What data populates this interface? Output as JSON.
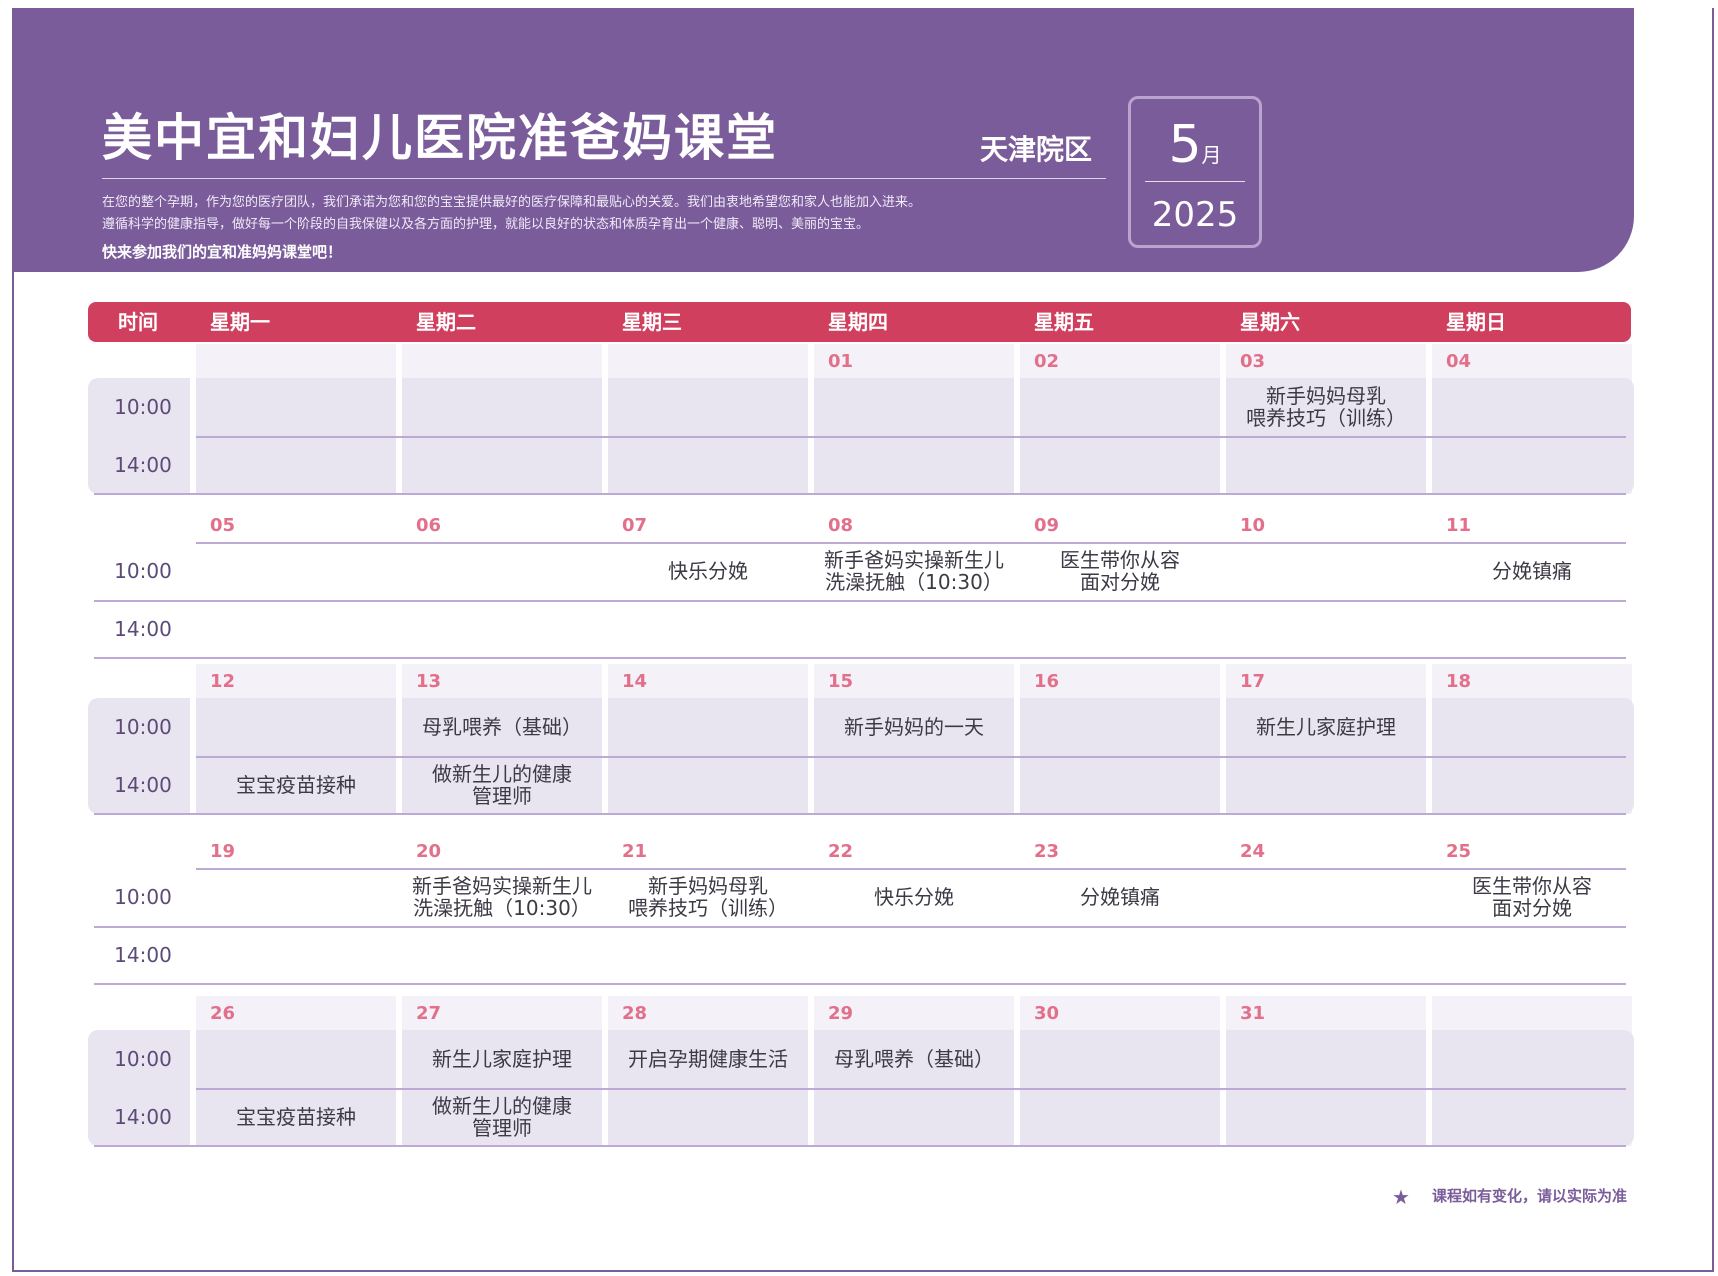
{
  "header": {
    "title": "美中宜和妇儿医院准爸妈课堂",
    "campus": "天津院区",
    "intro_lines": [
      "在您的整个孕期，作为您的医疗团队，我们承诺为您和您的宝宝提供最好的医疗保障和最贴心的关爱。我们由衷地希望您和家人也能加入进来。",
      "遵循科学的健康指导，做好每一个阶段的自我保健以及各方面的护理，就能以良好的状态和体质孕育出一个健康、聪明、美丽的宝宝。"
    ],
    "cta": "快来参加我们的宜和准妈妈课堂吧！",
    "month_num": "5",
    "month_unit": "月",
    "year": "2025"
  },
  "columns": [
    "时间",
    "星期一",
    "星期二",
    "星期三",
    "星期四",
    "星期五",
    "星期六",
    "星期日"
  ],
  "times": [
    "10:00",
    "14:00"
  ],
  "weeks": [
    {
      "dates": [
        "",
        "",
        "",
        "01",
        "02",
        "03",
        "04"
      ],
      "am": [
        "",
        "",
        "",
        "",
        "",
        "新手妈妈母乳\n喂养技巧（训练）",
        ""
      ],
      "pm": [
        "",
        "",
        "",
        "",
        "",
        "",
        ""
      ]
    },
    {
      "dates": [
        "05",
        "06",
        "07",
        "08",
        "09",
        "10",
        "11"
      ],
      "am": [
        "",
        "",
        "快乐分娩",
        "新手爸妈实操新生儿\n洗澡抚触（10:30）",
        "医生带你从容\n面对分娩",
        "",
        "分娩镇痛"
      ],
      "pm": [
        "",
        "",
        "",
        "",
        "",
        "",
        ""
      ]
    },
    {
      "dates": [
        "12",
        "13",
        "14",
        "15",
        "16",
        "17",
        "18"
      ],
      "am": [
        "",
        "母乳喂养（基础）",
        "",
        "新手妈妈的一天",
        "",
        "新生儿家庭护理",
        ""
      ],
      "pm": [
        "宝宝疫苗接种",
        "做新生儿的健康\n管理师",
        "",
        "",
        "",
        "",
        ""
      ]
    },
    {
      "dates": [
        "19",
        "20",
        "21",
        "22",
        "23",
        "24",
        "25"
      ],
      "am": [
        "",
        "新手爸妈实操新生儿\n洗澡抚触（10:30）",
        "新手妈妈母乳\n喂养技巧（训练）",
        "快乐分娩",
        "分娩镇痛",
        "",
        "医生带你从容\n面对分娩"
      ],
      "pm": [
        "",
        "",
        "",
        "",
        "",
        "",
        ""
      ]
    },
    {
      "dates": [
        "26",
        "27",
        "28",
        "29",
        "30",
        "31",
        ""
      ],
      "am": [
        "",
        "新生儿家庭护理",
        "开启孕期健康生活",
        "母乳喂养（基础）",
        "",
        "",
        ""
      ],
      "pm": [
        "宝宝疫苗接种",
        "做新生儿的健康\n管理师",
        "",
        "",
        "",
        "",
        ""
      ]
    }
  ],
  "footer_note": "课程如有变化，请以实际为准",
  "colors": {
    "brand_purple": "#7b5c9a",
    "header_red": "#d03f5d",
    "date_pink": "#e2708a",
    "shade_light": "#f4f1f8",
    "shade_row": "#e9e5f0"
  }
}
